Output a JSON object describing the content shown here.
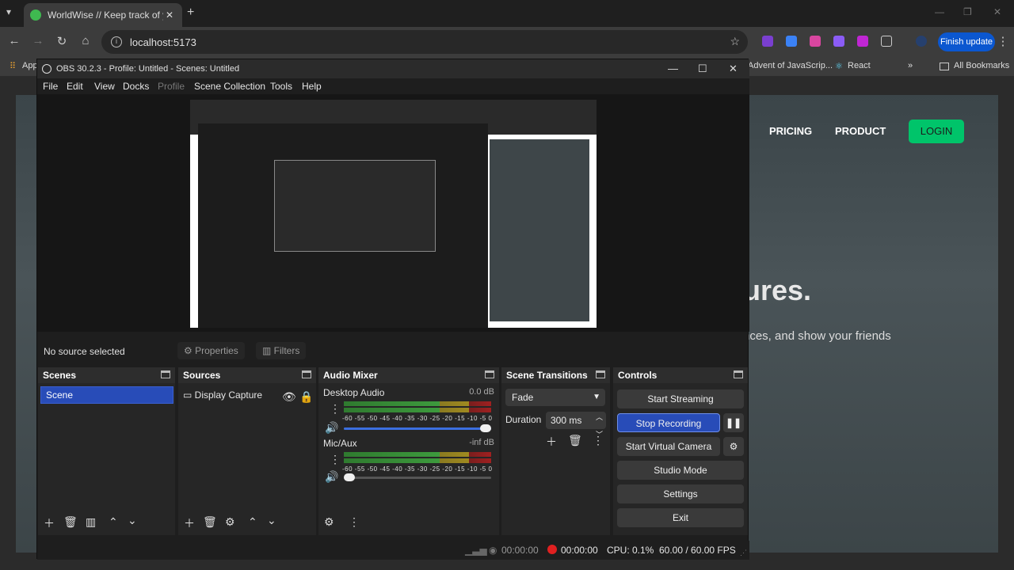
{
  "browser": {
    "tab_title": "WorldWise // Keep track of your",
    "tab_close": "✕",
    "new_tab": "+",
    "url": "localhost:5173",
    "finish_update": "Finish update",
    "bookmarks": [
      "App",
      "Advent of JavaScrip...",
      "React",
      "»",
      "All Bookmarks"
    ]
  },
  "site": {
    "nav": [
      "PRICING",
      "PRODUCT"
    ],
    "login": "LOGIN",
    "hero": "ures.",
    "sub": "nces, and show your friends",
    "accent": "#00c46a"
  },
  "obs": {
    "title": "OBS 30.2.3 - Profile: Untitled - Scenes: Untitled",
    "menu": [
      "File",
      "Edit",
      "View",
      "Docks",
      "Profile",
      "Scene Collection",
      "Tools",
      "Help"
    ],
    "no_source": "No source selected",
    "properties": "Properties",
    "filters": "Filters",
    "docks": {
      "scenes": "Scenes",
      "sources": "Sources",
      "audio_mixer": "Audio Mixer",
      "transitions": "Scene Transitions",
      "controls": "Controls"
    },
    "scene_items": [
      "Scene"
    ],
    "source_items": [
      "Display Capture"
    ],
    "audio": [
      {
        "name": "Desktop Audio",
        "level": "0.0 dB",
        "volume": 1.0
      },
      {
        "name": "Mic/Aux",
        "level": "-inf dB",
        "volume": 0.0
      }
    ],
    "meter_scale": "-60 -55 -50 -45 -40 -35 -30 -25 -20 -15 -10 -5 0",
    "transition": {
      "type": "Fade",
      "duration_label": "Duration",
      "duration": "300 ms"
    },
    "controls": {
      "start_streaming": "Start Streaming",
      "stop_recording": "Stop Recording",
      "start_virtual_camera": "Start Virtual Camera",
      "studio_mode": "Studio Mode",
      "settings": "Settings",
      "exit": "Exit"
    },
    "status": {
      "stream_time": "00:00:00",
      "rec_time": "00:00:00",
      "cpu": "CPU: 0.1%",
      "fps": "60.00 / 60.00 FPS"
    },
    "selected_color": "#284cb8",
    "recording_color": "#e02020"
  }
}
